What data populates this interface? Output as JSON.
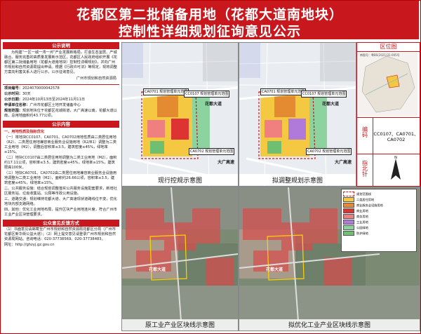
{
  "header": {
    "title_line1": "花都区第二批储备用地（花都大道南地块）",
    "title_line2": "控制性详细规划征询意见公示"
  },
  "notice": {
    "heading": "公示说明",
    "body": "为构建“一区一城一湾一河”产业发展新格局，打造生态宜居、产城融合、服务完善的高质量发展新示范区，花都区人民政府组织开展《花都区第二批储备用地（花都大道南地块）控制性详细规划》，并向广州市规划和自然资源局提出申请。根据《行政许可法》等规定，现将调整方案向利害关系人进行公示，公示征询意见。",
    "issuer": "广州市规划和自然资源局"
  },
  "info": {
    "project_code_label": "项目编号：",
    "project_code": "2024070000042578",
    "period_label": "公示时间：",
    "period": "30天",
    "dates_label": "公示日期：",
    "dates": "2024年10月13日至2024年11月11日",
    "applicant_label": "申请单位名称：",
    "applicant": "广州市花都区土地开发储备中心",
    "scope_label": "规划范围：",
    "scope": "规划地块位于花都区花城街道，大广高速以南，花都大道以南，总用地面积约43.77公顷。"
  },
  "content": {
    "heading": "公示内容",
    "s1_head": "一、用地性质及指标优化",
    "s1_body": "（一）将地块CC0107、CA0701、CA0702用地性质由二类居住用地（R2）、二类居住用地兼容商业服务业设施用地（R2/B1）调整为二类工业用地（M2），调整后容积率≤3.5，建筑密度≤45%，绿地率≥15%。",
    "s2_body": "（二）地块CC0107由二类居住用地调整为二类工业用地（M2），面积约17.11公顷，容积率≤3.5，建筑密度≤45%，绿地率≥15%，建筑限高100米。",
    "s3_body": "（三）地块CA0701、CA0702由二类居住用地兼容商业服务业设施用地调整为二类工业用地（M2），面积约26.66公顷，容积率≤3.5，建筑密度≤45%，绿地率≥15%。",
    "s4_body": "二、公共服务设施：结合规划调整落实公共服务设施配套要求，新增社区服务站、垃圾收集站、公厕等市政公用设施。",
    "s5_body": "三、道路交通：规划维持花都大道、大广高速现状道路线位不变，优化地块内部支路网络。",
    "s6_body": "四、其他：优化工业用地布局，提升区块产业用地连片度，符合广州市工业产业区块管理要求。"
  },
  "method": {
    "heading": "公众意见反馈方式",
    "body": "（1）书面意见请邮寄至广州市规划和自然资源局花都区分局（广州市花都区新华街公益大道）；（2）网上提交意见请登录广州市规划和自然资源局网站。咨询电话：020-37738569、020-37738483。",
    "link": "网址：http://ghzyj.gz.gov.cn"
  },
  "maps": {
    "current": {
      "label_a": "CA0701 规划管理单元范围",
      "label_b": "CC0107 规划管理单元范围",
      "label_c": "CA0702 规划管理单元范围",
      "road": "花都大道",
      "road2": "大广高速",
      "caption": "现行控规示意图"
    },
    "proposed": {
      "label_a": "CA0701 规划管理单元范围",
      "label_b": "CC0107 规划管理单元范围",
      "label_c": "CA0702 规划管理单元范围",
      "road": "花都大道",
      "road2": "大广高速",
      "caption": "拟调整规划示意图"
    },
    "original": {
      "road": "花都大道",
      "caption": "原工业产业区块线示意图"
    },
    "optimized": {
      "road": "花都大道",
      "caption": "拟优化工业产业区块线示意图"
    }
  },
  "sidebar": {
    "location_heading": "区位图",
    "map_number": "审图号：粤BS(2021)31-005号",
    "code_label": "编码",
    "code_line1": "CC0107、CA0701、",
    "code_line2": "CA0702",
    "north_label": "指北针"
  },
  "legend": [
    "规划范围线",
    "二类居住用地",
    "商业服务业设施用地",
    "商业用地",
    "商务用地",
    "工业用地",
    "公园绿地",
    "防护绿地"
  ]
}
